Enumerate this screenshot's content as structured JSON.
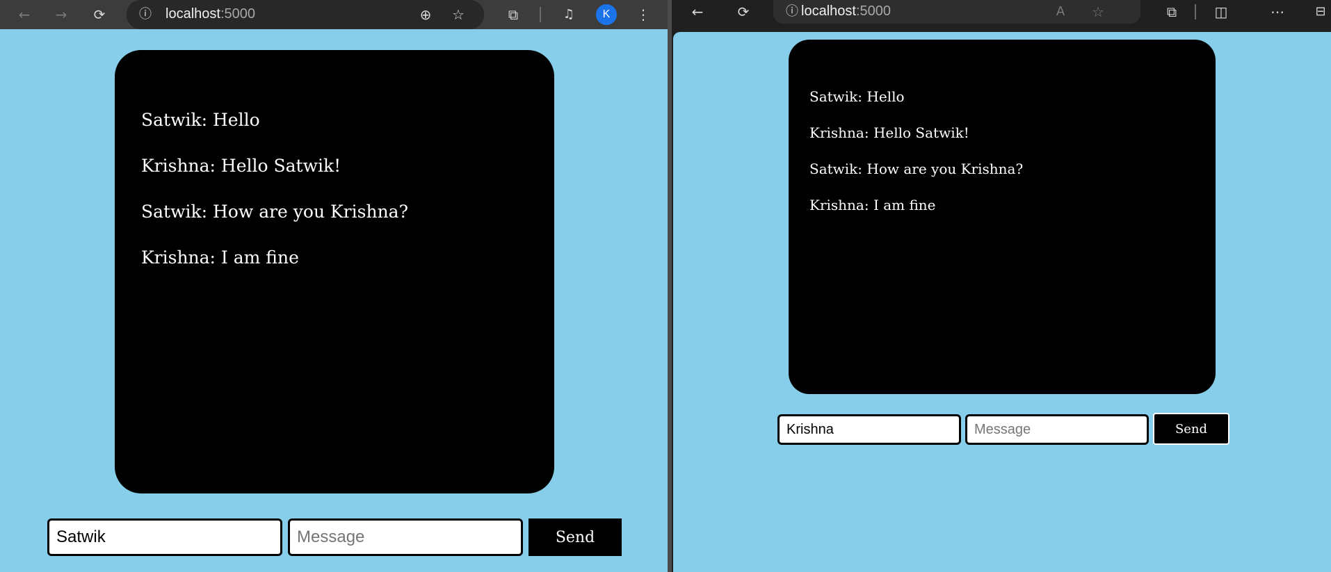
{
  "left_browser": {
    "url_host": "localhost",
    "url_port": ":5000",
    "profile_initial": "K",
    "icons": [
      "back-icon",
      "forward-icon",
      "reload-icon",
      "info-icon",
      "zoom-icon",
      "star-icon",
      "extensions-icon",
      "media-icon",
      "menu-icon"
    ],
    "chat": {
      "messages": [
        "Satwik: Hello",
        "Krishna: Hello Satwik!",
        "Satwik: How are you Krishna?",
        "Krishna: I am fine"
      ],
      "name_value": "Satwik",
      "message_placeholder": "Message",
      "send_label": "Send"
    }
  },
  "right_browser": {
    "url_host": "localhost",
    "url_port": ":5000",
    "icons": [
      "back-icon",
      "reload-icon",
      "info-icon",
      "read-aloud-icon",
      "favorite-icon",
      "extensions-icon",
      "split-screen-icon",
      "more-icon",
      "sidebar-icon"
    ],
    "chat": {
      "messages": [
        "Satwik: Hello",
        "Krishna: Hello Satwik!",
        "Satwik: How are you Krishna?",
        "Krishna: I am fine"
      ],
      "name_value": "Krishna",
      "message_placeholder": "Message",
      "send_label": "Send"
    }
  },
  "colors": {
    "page_background": "#87ceeb",
    "chat_background": "#000000",
    "chat_text": "#ffffff",
    "avatar": "#1a73e8"
  }
}
